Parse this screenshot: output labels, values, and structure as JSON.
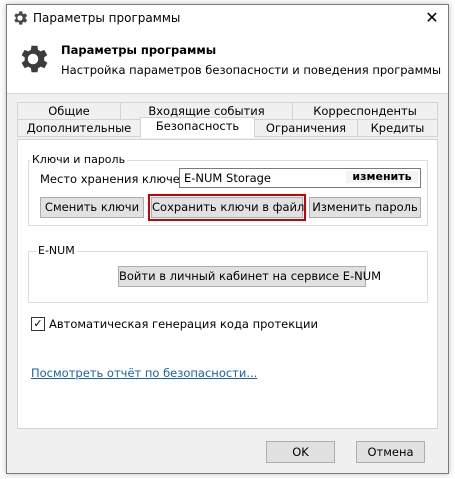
{
  "window": {
    "title": "Параметры программы",
    "close_glyph": "✕"
  },
  "header": {
    "title": "Параметры программы",
    "subtitle": "Настройка параметров безопасности и поведения программы"
  },
  "tabs_row1": [
    {
      "label": "Общие"
    },
    {
      "label": "Входящие события"
    },
    {
      "label": "Корреспонденты"
    }
  ],
  "tabs_row2": [
    {
      "label": "Дополнительные"
    },
    {
      "label": "Безопасность"
    },
    {
      "label": "Ограничения"
    },
    {
      "label": "Кредиты"
    }
  ],
  "keys_group": {
    "title": "Ключи и пароль",
    "storage_label": "Место хранения ключей:",
    "storage_value": "E-NUM Storage",
    "change_storage": "изменить",
    "change_keys": "Сменить ключи",
    "save_keys": "Сохранить ключи в файл",
    "change_password": "Изменить пароль"
  },
  "enum_group": {
    "title": "E-NUM",
    "login_button": "Войти в личный кабинет на сервисе E-NUM"
  },
  "auto_protect": {
    "label": "Автоматическая генерация кода протекции",
    "checked": true,
    "check_glyph": "✓"
  },
  "security_report_link": "Посмотреть отчёт по безопасности...",
  "footer": {
    "ok": "OK",
    "cancel": "Отмена"
  }
}
